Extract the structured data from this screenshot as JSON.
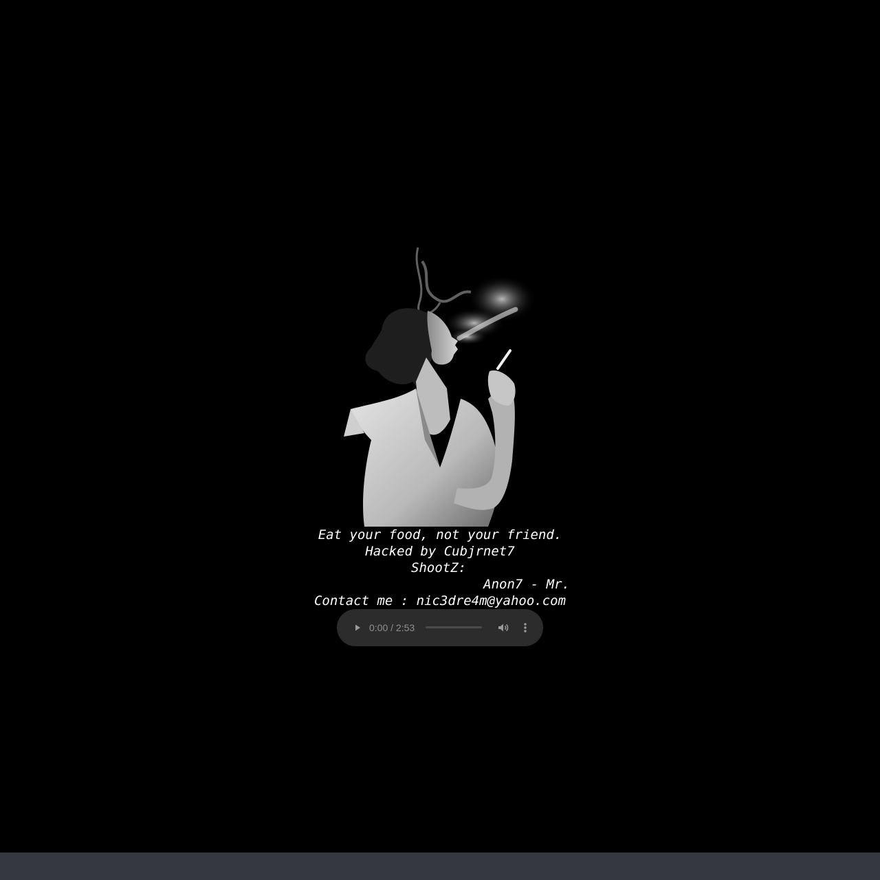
{
  "message": {
    "line1": "Eat your food, not your friend.",
    "line2": "Hacked by Cubjrnet7",
    "line3": "ShootZ:",
    "line4": "Anon7 - Mr.",
    "line5": "Contact me : nic3dre4m@yahoo.com"
  },
  "audio_player": {
    "time": "0:00 / 2:53",
    "progress": 0,
    "state": "paused"
  },
  "image": {
    "subject": "woman-smoking-photo"
  },
  "colors": {
    "background": "#000000",
    "text": "#ffffff",
    "player_bg": "#2c2c2c",
    "bottom_bar": "#353840"
  }
}
